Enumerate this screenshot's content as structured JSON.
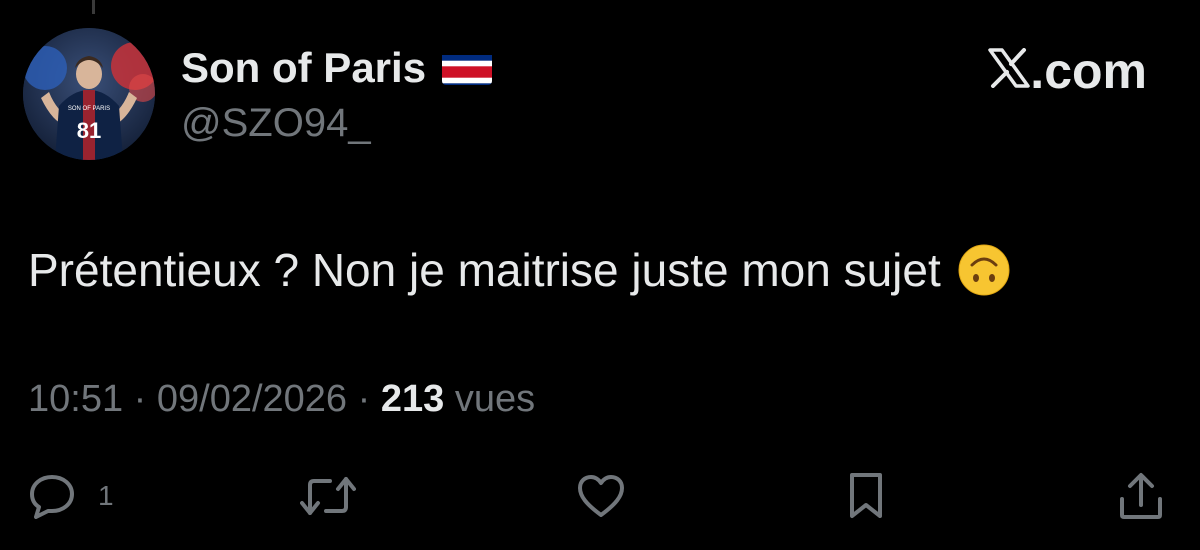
{
  "author": {
    "display_name": "Son of Paris",
    "flag_icon": "costa-rica-flag-icon",
    "handle": "@SZO94_",
    "avatar": {
      "jersey_text": "SON OF PARIS",
      "jersey_number": "81"
    }
  },
  "brand": {
    "label": ".com",
    "logo_icon": "x-logo-icon"
  },
  "tweet": {
    "text": "Prétentieux ? Non je maitrise juste mon sujet",
    "emoji": "upside-down-face-emoji"
  },
  "meta": {
    "time": "10:51",
    "separator": " · ",
    "date": "09/02/2026",
    "views_count": "213",
    "views_label": "vues"
  },
  "actions": {
    "reply_count": "1",
    "icons": [
      "reply-icon",
      "retweet-icon",
      "like-icon",
      "bookmark-icon",
      "share-icon"
    ]
  },
  "colors": {
    "background": "#000000",
    "primary_text": "#e7e9ea",
    "secondary_text": "#71767b"
  }
}
